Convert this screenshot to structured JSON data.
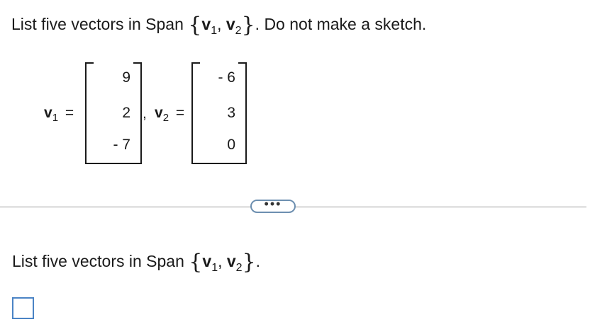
{
  "question": {
    "prompt_prefix": "List five vectors in Span",
    "brace_open": "{",
    "brace_close": "}",
    "vector1_symbol": "v",
    "vector1_index": "1",
    "separator": ",",
    "vector2_symbol": "v",
    "vector2_index": "2",
    "prompt_suffix": ". Do not make a sketch."
  },
  "vectors": {
    "v1": {
      "symbol": "v",
      "index": "1",
      "equals": "=",
      "entries": [
        "9",
        "2",
        "- 7"
      ]
    },
    "comma": ",",
    "v2": {
      "symbol": "v",
      "index": "2",
      "equals": "=",
      "entries": [
        "- 6",
        "3",
        "0"
      ]
    }
  },
  "more_button": {
    "label": "•••"
  },
  "answer_section": {
    "prompt_prefix": "List five vectors in Span",
    "period": "."
  },
  "colors": {
    "accent_border": "#4b84c5",
    "button_border": "#6d8fb0",
    "divider": "#9a9a9a",
    "text": "#1a1a1a"
  }
}
